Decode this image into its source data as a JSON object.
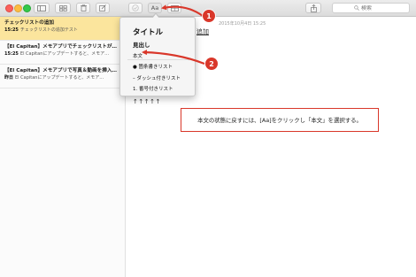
{
  "search": {
    "placeholder": "検索"
  },
  "notes": [
    {
      "title": "チェックリストの追加",
      "time": "15:25",
      "preview": "チェックリストの追加テスト"
    },
    {
      "title": "【El Capitan】メモアプリでチェックリストが…",
      "time": "15:25",
      "preview": "El Capitanにアップデートすると、メモア…"
    },
    {
      "title": "【El Capitan】メモアプリで写真＆動画を挿入…",
      "time": "昨日",
      "preview": "El Capitanにアップデートすると、メモア…"
    }
  ],
  "editor": {
    "date": "2015年10月4日 15:25",
    "heading_fragment": "追加",
    "arrows": "↑↑↑↑↑"
  },
  "format_menu": {
    "title": "タイトル",
    "heading": "見出し",
    "body": "本文",
    "bulleted": "● 箇条書きリスト",
    "dashed": "– ダッシュ付きリスト",
    "numbered": "1. 番号付きリスト"
  },
  "annotations": {
    "badge1": "1",
    "badge2": "2",
    "callout": "本文の状態に戻すには、[Aa]をクリックし「本文」を選択する。",
    "color": "#d9372a"
  },
  "toolbar": {
    "format_button": "Aa",
    "icons": [
      "sidebar-toggle-icon",
      "grid-icon",
      "trash-icon",
      "compose-icon",
      "checklist-icon",
      "format-icon",
      "table-icon",
      "share-icon",
      "search-icon"
    ]
  }
}
